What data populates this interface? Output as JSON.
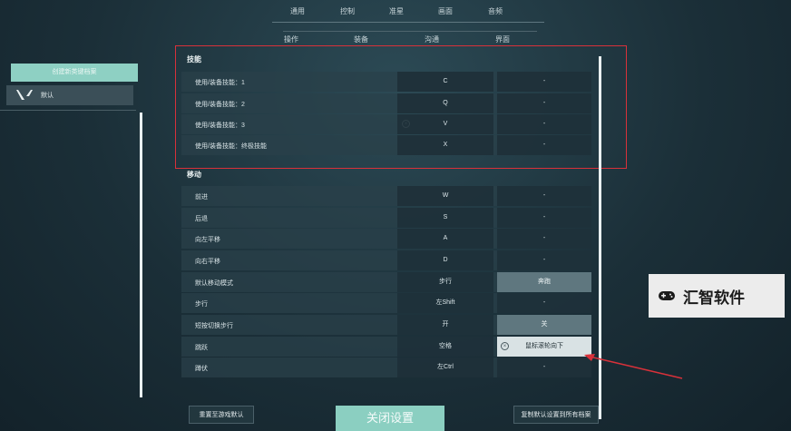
{
  "top_tabs": [
    "通用",
    "控制",
    "准星",
    "画面",
    "音频"
  ],
  "sub_tabs": [
    "操作",
    "装备",
    "沟通",
    "界面"
  ],
  "sidebar": {
    "create_profile": "创建新类键档案",
    "profile_name": "默认"
  },
  "sections": {
    "skills": {
      "header": "技能",
      "rows": [
        {
          "label": "使用/装备技能：1",
          "primary": "C",
          "secondary": "-"
        },
        {
          "label": "使用/装备技能：2",
          "primary": "Q",
          "secondary": "-"
        },
        {
          "label": "使用/装备技能：3",
          "primary": "V",
          "secondary": "-"
        },
        {
          "label": "使用/装备技能：终极技能",
          "primary": "X",
          "secondary": "-"
        }
      ]
    },
    "movement": {
      "header": "移动",
      "rows": [
        {
          "label": "前进",
          "primary": "W",
          "secondary": "-"
        },
        {
          "label": "后退",
          "primary": "S",
          "secondary": "-"
        },
        {
          "label": "向左平移",
          "primary": "A",
          "secondary": "-"
        },
        {
          "label": "向右平移",
          "primary": "D",
          "secondary": "-"
        },
        {
          "label": "默认移动模式",
          "primary": "步行",
          "secondary": "奔跑"
        },
        {
          "label": "步行",
          "primary": "左Shift",
          "secondary": "-"
        },
        {
          "label": "短按切换步行",
          "primary": "开",
          "secondary": "关"
        },
        {
          "label": "跳跃",
          "primary": "空格",
          "secondary": "鼠标滚轮向下"
        },
        {
          "label": "蹲伏",
          "primary": "左Ctrl",
          "secondary": "-"
        }
      ]
    }
  },
  "buttons": {
    "reset": "重置至游戏默认",
    "close": "关闭设置",
    "copy": "复制默认设置到所有档案"
  },
  "watermark": "汇智软件",
  "colors": {
    "accent": "#8ed0c3",
    "highlight": "#d8313a"
  }
}
